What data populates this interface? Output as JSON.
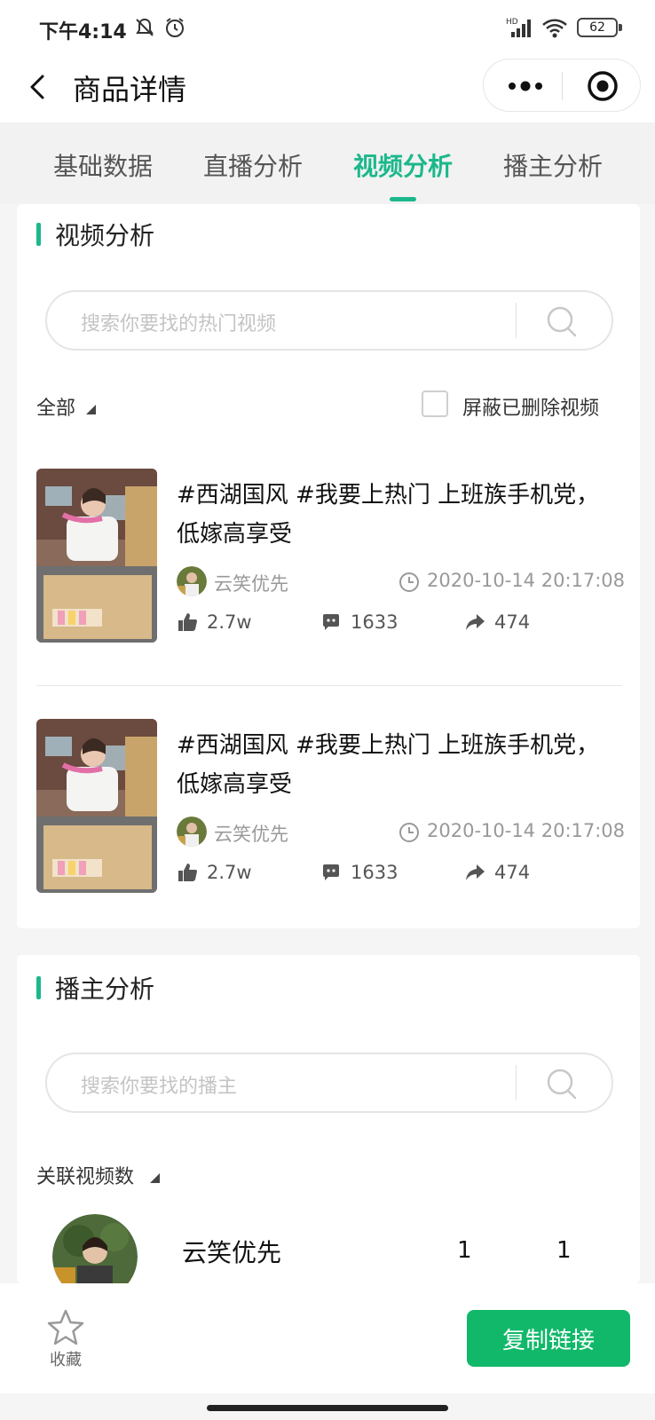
{
  "status_bar": {
    "time": "下午4:14",
    "battery": "62",
    "icons": [
      "mute-icon",
      "alarm-icon",
      "hd-signal-icon",
      "wifi-icon",
      "battery-icon"
    ]
  },
  "nav": {
    "title": "商品详情",
    "icons": [
      "back-icon",
      "more-icon",
      "close-icon"
    ]
  },
  "tabs": [
    {
      "label": "基础数据",
      "active": false
    },
    {
      "label": "直播分析",
      "active": false
    },
    {
      "label": "视频分析",
      "active": true
    },
    {
      "label": "播主分析",
      "active": false
    }
  ],
  "video_section": {
    "title": "视频分析",
    "search_placeholder": "搜索你要找的热门视频",
    "filter_label": "全部",
    "hide_deleted_label": "屏蔽已删除视频",
    "hide_deleted_checked": false,
    "items": [
      {
        "title": "#西湖国风 #我要上热门  上班族手机党，低嫁高享受",
        "author": "云笑优先",
        "time": "2020-10-14 20:17:08",
        "likes": "2.7w",
        "comments": "1633",
        "shares": "474"
      },
      {
        "title": "#西湖国风 #我要上热门  上班族手机党，低嫁高享受",
        "author": "云笑优先",
        "time": "2020-10-14 20:17:08",
        "likes": "2.7w",
        "comments": "1633",
        "shares": "474"
      }
    ]
  },
  "anchor_section": {
    "title": "播主分析",
    "search_placeholder": "搜索你要找的播主",
    "sort_label": "关联视频数",
    "rows": [
      {
        "name": "云笑优先",
        "value1": "1",
        "value2": "1"
      }
    ]
  },
  "bottom_bar": {
    "favorite_label": "收藏",
    "copy_link_label": "复制链接"
  },
  "colors": {
    "accent": "#1cb88c",
    "button": "#11b86a"
  }
}
